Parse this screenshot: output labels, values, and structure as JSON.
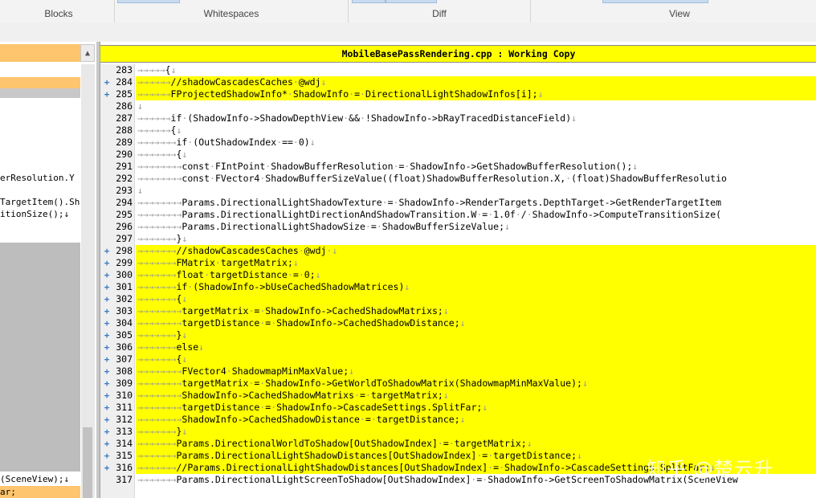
{
  "ribbon": {
    "groups": [
      "Blocks",
      "Whitespaces",
      "Diff",
      "View"
    ]
  },
  "left_pane": {
    "lines": [
      "erResolution.Y",
      "",
      "TargetItem().Sh",
      "itionSize();↓",
      "(SceneView);↓",
      "ar;"
    ]
  },
  "right_pane": {
    "title": "MobileBasePassRendering.cpp : Working Copy",
    "lines": [
      {
        "num": "283",
        "mark": "",
        "added": false,
        "text": "→→→→→{↓"
      },
      {
        "num": "284",
        "mark": "+",
        "added": true,
        "text": "→→→→→→//shadowCascadesCaches·@wdj↓"
      },
      {
        "num": "285",
        "mark": "+",
        "added": true,
        "text": "→→→→→→FProjectedShadowInfo*·ShadowInfo·=·DirectionalLightShadowInfos[i];↓"
      },
      {
        "num": "286",
        "mark": "",
        "added": false,
        "text": "↓"
      },
      {
        "num": "287",
        "mark": "",
        "added": false,
        "text": "→→→→→→if·(ShadowInfo->ShadowDepthView·&&·!ShadowInfo->bRayTracedDistanceField)↓"
      },
      {
        "num": "288",
        "mark": "",
        "added": false,
        "text": "→→→→→→{↓"
      },
      {
        "num": "289",
        "mark": "",
        "added": false,
        "text": "→→→→→→→if·(OutShadowIndex·==·0)↓"
      },
      {
        "num": "290",
        "mark": "",
        "added": false,
        "text": "→→→→→→→{↓"
      },
      {
        "num": "291",
        "mark": "",
        "added": false,
        "text": "→→→→→→→→const·FIntPoint·ShadowBufferResolution·=·ShadowInfo->GetShadowBufferResolution();↓"
      },
      {
        "num": "292",
        "mark": "",
        "added": false,
        "text": "→→→→→→→→const·FVector4·ShadowBufferSizeValue((float)ShadowBufferResolution.X,·(float)ShadowBufferResolutio"
      },
      {
        "num": "293",
        "mark": "",
        "added": false,
        "text": "↓"
      },
      {
        "num": "294",
        "mark": "",
        "added": false,
        "text": "→→→→→→→→Params.DirectionalLightShadowTexture·=·ShadowInfo->RenderTargets.DepthTarget->GetRenderTargetItem"
      },
      {
        "num": "295",
        "mark": "",
        "added": false,
        "text": "→→→→→→→→Params.DirectionalLightDirectionAndShadowTransition.W·=·1.0f·/·ShadowInfo->ComputeTransitionSize("
      },
      {
        "num": "296",
        "mark": "",
        "added": false,
        "text": "→→→→→→→→Params.DirectionalLightShadowSize·=·ShadowBufferSizeValue;↓"
      },
      {
        "num": "297",
        "mark": "",
        "added": false,
        "text": "→→→→→→→}↓"
      },
      {
        "num": "298",
        "mark": "+",
        "added": true,
        "text": "→→→→→→→//shadowCascadesCaches·@wdj·↓"
      },
      {
        "num": "299",
        "mark": "+",
        "added": true,
        "text": "→→→→→→→FMatrix·targetMatrix;↓"
      },
      {
        "num": "300",
        "mark": "+",
        "added": true,
        "text": "→→→→→→→float·targetDistance·=·0;↓"
      },
      {
        "num": "301",
        "mark": "+",
        "added": true,
        "text": "→→→→→→→if·(ShadowInfo->bUseCachedShadowMatrices)↓"
      },
      {
        "num": "302",
        "mark": "+",
        "added": true,
        "text": "→→→→→→→{↓"
      },
      {
        "num": "303",
        "mark": "+",
        "added": true,
        "text": "→→→→→→→→targetMatrix·=·ShadowInfo->CachedShadowMatrixs;↓"
      },
      {
        "num": "304",
        "mark": "+",
        "added": true,
        "text": "→→→→→→→→targetDistance·=·ShadowInfo->CachedShadowDistance;↓"
      },
      {
        "num": "305",
        "mark": "+",
        "added": true,
        "text": "→→→→→→→}↓"
      },
      {
        "num": "306",
        "mark": "+",
        "added": true,
        "text": "→→→→→→→else↓"
      },
      {
        "num": "307",
        "mark": "+",
        "added": true,
        "text": "→→→→→→→{↓"
      },
      {
        "num": "308",
        "mark": "+",
        "added": true,
        "text": "→→→→→→→→FVector4·ShadowmapMinMaxValue;↓"
      },
      {
        "num": "309",
        "mark": "+",
        "added": true,
        "text": "→→→→→→→→targetMatrix·=·ShadowInfo->GetWorldToShadowMatrix(ShadowmapMinMaxValue);↓"
      },
      {
        "num": "310",
        "mark": "+",
        "added": true,
        "text": "→→→→→→→→ShadowInfo->CachedShadowMatrixs·=·targetMatrix;↓"
      },
      {
        "num": "311",
        "mark": "+",
        "added": true,
        "text": "→→→→→→→→targetDistance·=·ShadowInfo->CascadeSettings.SplitFar;↓"
      },
      {
        "num": "312",
        "mark": "+",
        "added": true,
        "text": "→→→→→→→→ShadowInfo->CachedShadowDistance·=·targetDistance;↓"
      },
      {
        "num": "313",
        "mark": "+",
        "added": true,
        "text": "→→→→→→→}↓"
      },
      {
        "num": "314",
        "mark": "+",
        "added": true,
        "text": "→→→→→→→Params.DirectionalWorldToShadow[OutShadowIndex]·=·targetMatrix;↓"
      },
      {
        "num": "315",
        "mark": "+",
        "added": true,
        "text": "→→→→→→→Params.DirectionalLightShadowDistances[OutShadowIndex]·=·targetDistance;↓"
      },
      {
        "num": "316",
        "mark": "+",
        "added": true,
        "text": "→→→→→→→//Params.DirectionalLightShadowDistances[OutShadowIndex]·=·ShadowInfo->CascadeSettings.SplitFar;↓"
      },
      {
        "num": "317",
        "mark": "",
        "added": false,
        "text": "→→→→→→→Params.DirectionalLightScreenToShadow[OutShadowIndex]·=·ShadowInfo->GetScreenToShadowMatrix(SceneView"
      }
    ]
  },
  "watermark": "知乎 @楚云升",
  "colors": {
    "added_bg": "#ffff00",
    "left_header": "#ffc56e",
    "marker": "#3a7ac0"
  }
}
